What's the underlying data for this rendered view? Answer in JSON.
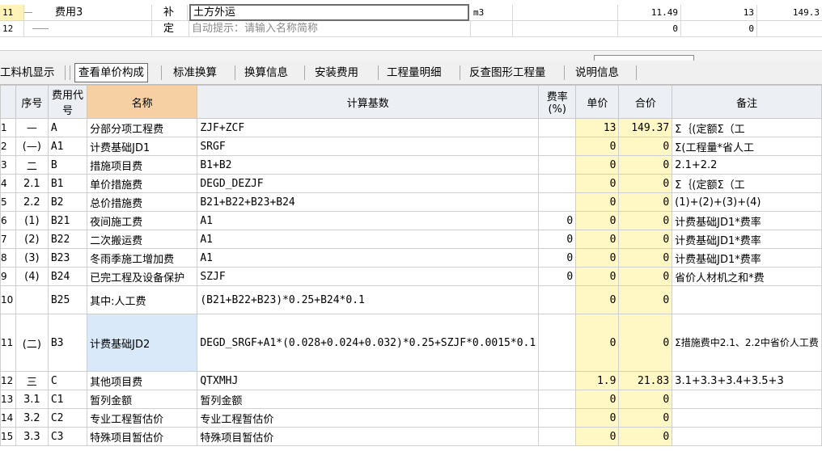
{
  "top_rows": [
    {
      "num": "11",
      "name": "费用3",
      "type": "补",
      "content": "土方外运",
      "unit": "m3",
      "qty": "11.49",
      "price": "13",
      "total": "149.3"
    },
    {
      "num": "12",
      "name": "",
      "type": "定",
      "content": "自动提示：请输入名称简称",
      "unit": "",
      "qty": "0",
      "price": "0",
      "total": ""
    }
  ],
  "tabs": [
    {
      "label": "工料机显示"
    },
    {
      "label": "查看单价构成"
    },
    {
      "label": "标准换算"
    },
    {
      "label": "换算信息"
    },
    {
      "label": "安装费用"
    },
    {
      "label": "工程量明细"
    },
    {
      "label": "反查图形工程量"
    },
    {
      "label": "说明信息"
    }
  ],
  "table": {
    "headers": [
      "序号",
      "费用代号",
      "名称",
      "计算基数",
      "费率(%)",
      "单价",
      "合价",
      "备注"
    ],
    "rows": [
      {
        "n": "1",
        "seq": "—",
        "code": "A",
        "name": "分部分项工程费",
        "base": "ZJF+ZCF",
        "rate": "",
        "price": "13",
        "total": "149.37",
        "note": "Σ｛(定额Σ（工"
      },
      {
        "n": "2",
        "seq": "(—)",
        "code": "A1",
        "name": "计费基础JD1",
        "base": "SRGF",
        "rate": "",
        "price": "0",
        "total": "0",
        "note": "Σ(工程量*省人工"
      },
      {
        "n": "3",
        "seq": "二",
        "code": "B",
        "name": "措施项目费",
        "base": "B1+B2",
        "rate": "",
        "price": "0",
        "total": "0",
        "note": "2.1+2.2"
      },
      {
        "n": "4",
        "seq": "2.1",
        "code": "B1",
        "name": "单价措施费",
        "base": "DEGD_DEZJF",
        "rate": "",
        "price": "0",
        "total": "0",
        "note": "Σ｛(定额Σ（工"
      },
      {
        "n": "5",
        "seq": "2.2",
        "code": "B2",
        "name": "总价措施费",
        "base": "B21+B22+B23+B24",
        "rate": "",
        "price": "0",
        "total": "0",
        "note": "(1)+(2)+(3)+(4)"
      },
      {
        "n": "6",
        "seq": "(1)",
        "code": "B21",
        "name": "夜间施工费",
        "base": "A1",
        "rate": "0",
        "price": "0",
        "total": "0",
        "note": "计费基础JD1*费率"
      },
      {
        "n": "7",
        "seq": "(2)",
        "code": "B22",
        "name": "二次搬运费",
        "base": "A1",
        "rate": "0",
        "price": "0",
        "total": "0",
        "note": "计费基础JD1*费率"
      },
      {
        "n": "8",
        "seq": "(3)",
        "code": "B23",
        "name": "冬雨季施工增加费",
        "base": "A1",
        "rate": "0",
        "price": "0",
        "total": "0",
        "note": "计费基础JD1*费率"
      },
      {
        "n": "9",
        "seq": "(4)",
        "code": "B24",
        "name": "已完工程及设备保护",
        "base": "SZJF",
        "rate": "0",
        "price": "0",
        "total": "0",
        "note": "省价人材机之和*费"
      },
      {
        "n": "10",
        "seq": "",
        "code": "B25",
        "name": "其中:人工费",
        "base": "(B21+B22+B23)*0.25+B24*0.1",
        "rate": "",
        "price": "0",
        "total": "0",
        "note": ""
      },
      {
        "n": "11",
        "seq": "(二)",
        "code": "B3",
        "name": "计费基础JD2",
        "base": "DEGD_SRGF+A1*(0.028+0.024+0.032)*0.25+SZJF*0.0015*0.1",
        "rate": "",
        "price": "0",
        "total": "0",
        "note": "Σ措施费中2.1、2.2中省价人工费"
      },
      {
        "n": "12",
        "seq": "三",
        "code": "C",
        "name": "其他项目费",
        "base": "QTXMHJ",
        "rate": "",
        "price": "1.9",
        "total": "21.83",
        "note": "3.1+3.3+3.4+3.5+3"
      },
      {
        "n": "13",
        "seq": "3.1",
        "code": "C1",
        "name": "暂列金额",
        "base": "暂列金额",
        "rate": "",
        "price": "0",
        "total": "0",
        "note": ""
      },
      {
        "n": "14",
        "seq": "3.2",
        "code": "C2",
        "name": "专业工程暂估价",
        "base": "专业工程暂估价",
        "rate": "",
        "price": "0",
        "total": "0",
        "note": ""
      },
      {
        "n": "15",
        "seq": "3.3",
        "code": "C3",
        "name": "特殊项目暂估价",
        "base": "特殊项目暂估价",
        "rate": "",
        "price": "0",
        "total": "0",
        "note": ""
      }
    ]
  }
}
